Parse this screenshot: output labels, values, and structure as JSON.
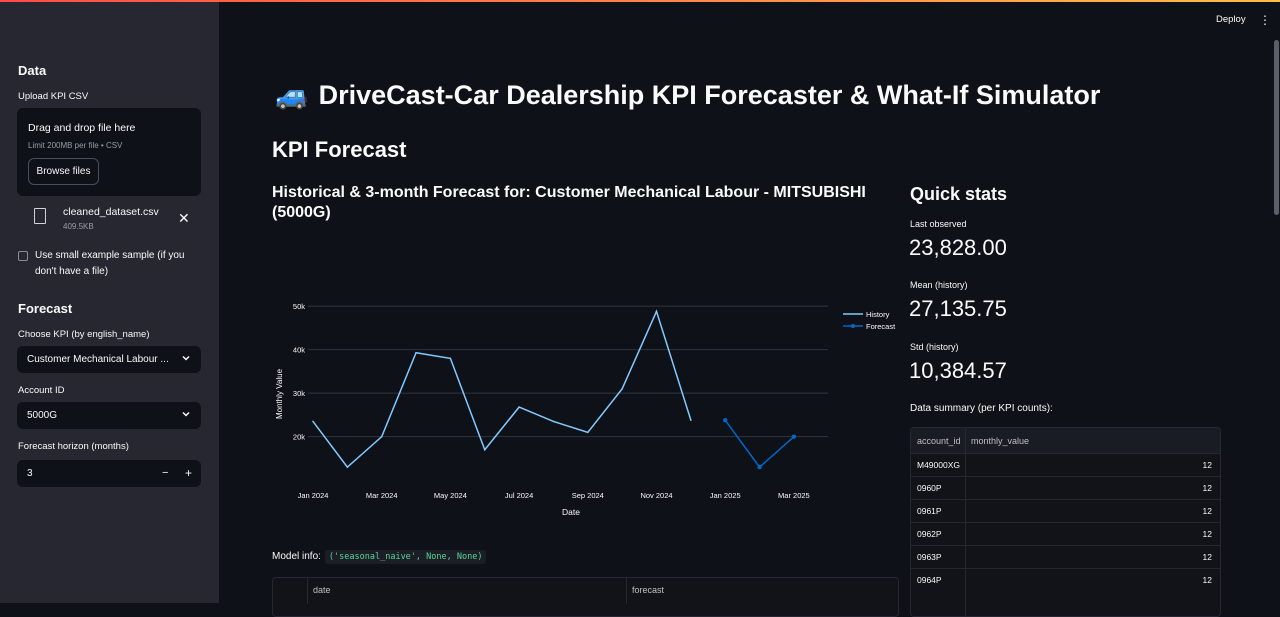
{
  "sidebar": {
    "data_heading": "Data",
    "upload_label": "Upload KPI CSV",
    "drop_text": "Drag and drop file here",
    "limit_text": "Limit 200MB per file • CSV",
    "browse_button": "Browse files",
    "file_name": "cleaned_dataset.csv",
    "file_size": "409.5KB",
    "sample_checkbox_label": "Use small example sample (if you don't have a file)",
    "forecast_heading": "Forecast",
    "kpi_label": "Choose KPI (by english_name)",
    "kpi_value": "Customer Mechanical Labour ...",
    "account_label": "Account ID",
    "account_value": "5000G",
    "horizon_label": "Forecast horizon (months)",
    "horizon_value": "3"
  },
  "header": {
    "deploy_label": "Deploy",
    "menu_glyph": "⋮"
  },
  "main": {
    "title_icon": "🚙",
    "title": "DriveCast-Car Dealership KPI Forecaster & What-If Simulator",
    "section_title": "KPI Forecast",
    "chart_heading": "Historical & 3-month Forecast for: Customer Mechanical Labour - MITSUBISHI (5000G)",
    "model_info_label": "Model info:",
    "model_info_code": "('seasonal_naive', None, None)",
    "forecast_table_columns": [
      "date",
      "forecast"
    ]
  },
  "quick_stats": {
    "title": "Quick stats",
    "last_observed_label": "Last observed",
    "last_observed_value": "23,828.00",
    "mean_label": "Mean (history)",
    "mean_value": "27,135.75",
    "std_label": "Std (history)",
    "std_value": "10,384.57",
    "summary_label": "Data summary (per KPI counts):",
    "summary_columns": [
      "account_id",
      "monthly_value"
    ],
    "summary_rows": [
      {
        "account_id": "M49000XG",
        "monthly_value": "12"
      },
      {
        "account_id": "0960P",
        "monthly_value": "12"
      },
      {
        "account_id": "0961P",
        "monthly_value": "12"
      },
      {
        "account_id": "0962P",
        "monthly_value": "12"
      },
      {
        "account_id": "0963P",
        "monthly_value": "12"
      },
      {
        "account_id": "0964P",
        "monthly_value": "12"
      }
    ]
  },
  "colors": {
    "history": "#83c9ff",
    "forecast": "#0068c9",
    "accent": "#ff4b4b"
  },
  "chart_data": {
    "type": "line",
    "xlabel": "Date",
    "ylabel": "Monthly Value",
    "ytick_labels": [
      "20k",
      "30k",
      "40k",
      "50k"
    ],
    "yticks": [
      20000,
      30000,
      40000,
      50000
    ],
    "ylim": [
      10500,
      50500
    ],
    "xtick_labels": [
      "Jan 2024",
      "Mar 2024",
      "May 2024",
      "Jul 2024",
      "Sep 2024",
      "Nov 2024",
      "Jan 2025",
      "Mar 2025"
    ],
    "xtick_index": [
      0,
      2,
      4,
      6,
      8,
      10,
      12,
      14
    ],
    "legend_placement": "top-right",
    "series": [
      {
        "name": "History",
        "x_index": [
          0,
          1,
          2,
          3,
          4,
          5,
          6,
          7,
          8,
          9,
          10,
          11
        ],
        "values": [
          23500,
          13000,
          20000,
          39300,
          38000,
          17000,
          26800,
          23500,
          21000,
          31000,
          48800,
          23800
        ]
      },
      {
        "name": "Forecast",
        "x_index": [
          12,
          13,
          14
        ],
        "values": [
          23800,
          13000,
          20000
        ]
      }
    ]
  }
}
